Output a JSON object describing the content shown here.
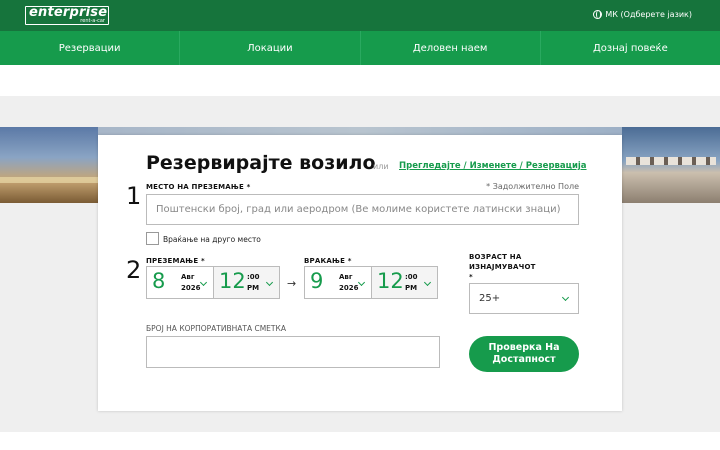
{
  "header": {
    "logo_word": "enterprise",
    "logo_sub": "rent-a-car",
    "language": "МК (Одберете јазик)"
  },
  "nav": {
    "items": [
      "Резервации",
      "Локации",
      "Деловен наем",
      "Дознај повеќе"
    ]
  },
  "form": {
    "title": "Резервирајте возило",
    "or_text": "или",
    "view_link": "Прегледајте / Изменете / Резервација",
    "step1": "1",
    "step2": "2",
    "pickup_location_label": "МЕСТО НА ПРЕЗЕМАЊЕ *",
    "required_note": "* Задолжително Поле",
    "location_placeholder": "Поштенски број, град или аеродром (Ве молиме користете латински знаци)",
    "return_different_label": "Враќање на друго место",
    "pickup_label": "ПРЕЗЕМАЊЕ *",
    "pickup": {
      "day": "8",
      "month": "Авг",
      "year": "2026",
      "hour": "12",
      "minute": ":00",
      "ampm": "PM"
    },
    "return_label": "ВРАКАЊЕ *",
    "return": {
      "day": "9",
      "month": "Авг",
      "year": "2026",
      "hour": "12",
      "minute": ":00",
      "ampm": "PM"
    },
    "arrow": "→",
    "age_label_1": "ВОЗРАСТ НА",
    "age_label_2": "ИЗНАЈМУВАЧОТ",
    "age_label_3": "*",
    "age_value": "25+",
    "corporate_label": "БРОЈ НА КОРПОРАТИВНАТА СМЕТКА",
    "submit_label": "Проверка На Достапност"
  },
  "colors": {
    "brand_dark": "#16743c",
    "brand": "#169b4c"
  }
}
